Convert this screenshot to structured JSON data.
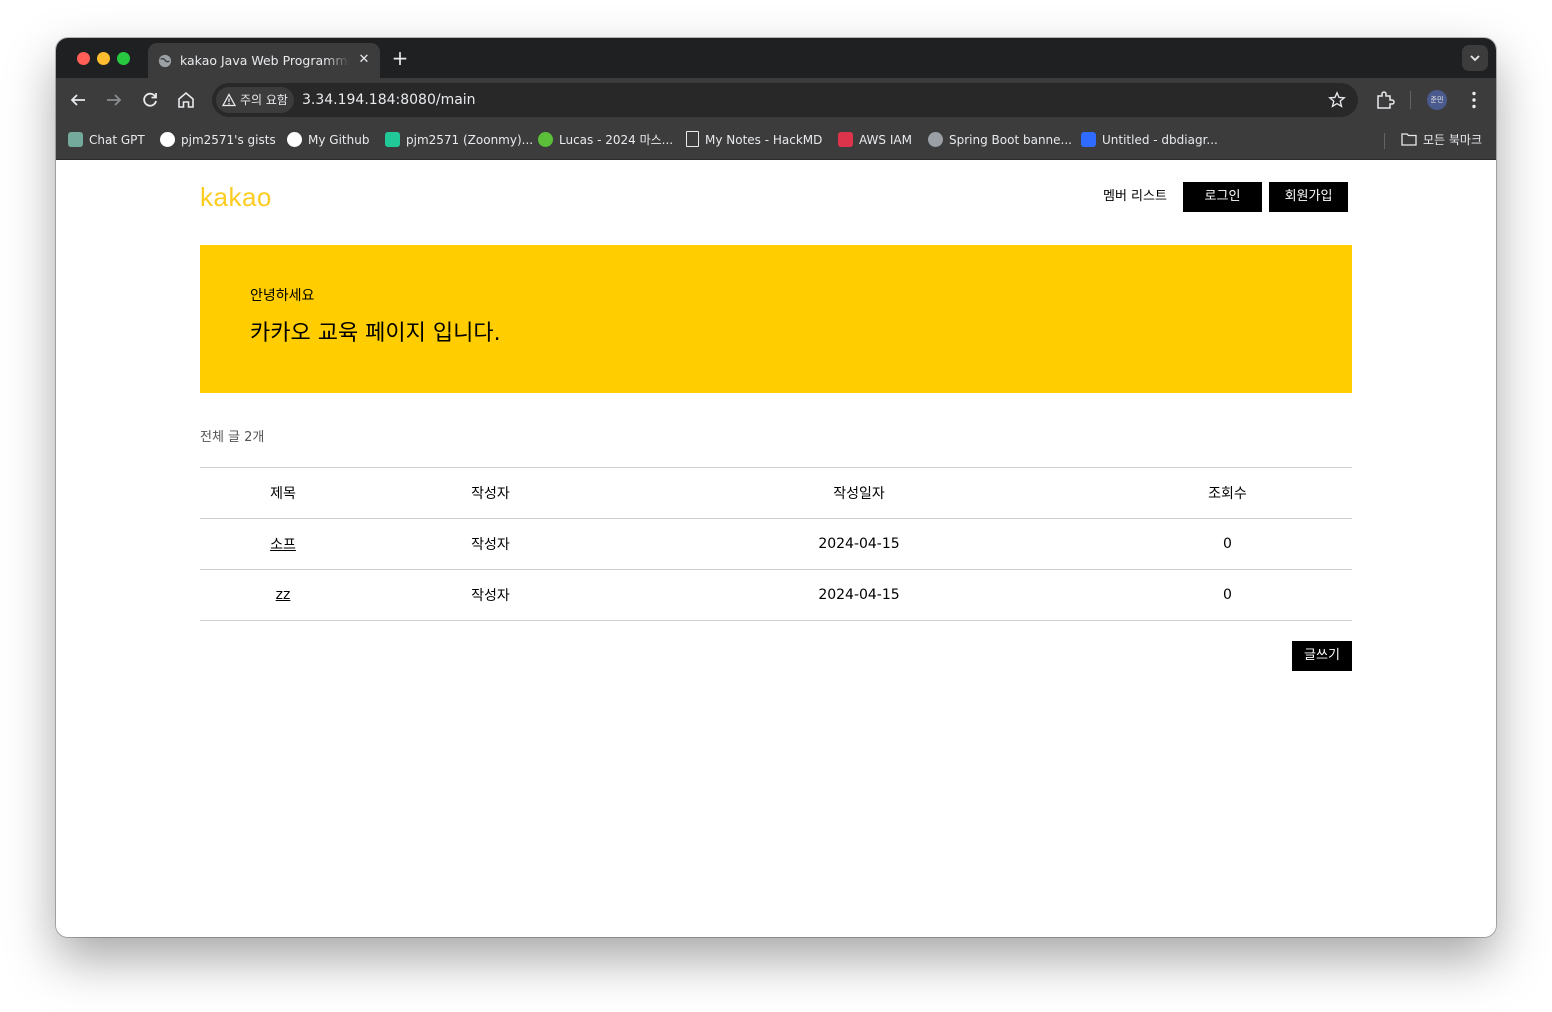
{
  "browser": {
    "tab": {
      "title": "kakao Java Web Programming"
    },
    "address": {
      "security_label": "주의 요함",
      "url": "3.34.194.184:8080/main"
    },
    "bookmarks": [
      {
        "label": "Chat GPT",
        "icon": "chatgpt-icon",
        "color": "#74aa9c"
      },
      {
        "label": "pjm2571's gists",
        "icon": "github-icon",
        "color": "#ffffff"
      },
      {
        "label": "My Github",
        "icon": "github-icon",
        "color": "#ffffff"
      },
      {
        "label": "pjm2571 (Zoonmy)...",
        "icon": "velog-icon",
        "color": "#20c997"
      },
      {
        "label": "Lucas - 2024 마스...",
        "icon": "clover-icon",
        "color": "#5bbf3a"
      },
      {
        "label": "My Notes - HackMD",
        "icon": "document-icon",
        "color": "#e8eaed"
      },
      {
        "label": "AWS IAM",
        "icon": "aws-icon",
        "color": "#dd344c"
      },
      {
        "label": "Spring Boot banne...",
        "icon": "gear-globe-icon",
        "color": "#9aa0a6"
      },
      {
        "label": "Untitled - dbdiagr...",
        "icon": "dbdiagram-icon",
        "color": "#2f6bff"
      }
    ],
    "all_bookmarks_label": "모든 북마크",
    "profile_label": "준민"
  },
  "site": {
    "logo": "kakao",
    "nav": {
      "member_list": "멤버 리스트",
      "login": "로그인",
      "signup": "회원가입"
    },
    "hero": {
      "greeting": "안녕하세요",
      "headline": "카카오 교육 페이지 입니다."
    },
    "board": {
      "count_text": "전체 글 2개",
      "columns": [
        "제목",
        "작성자",
        "작성일자",
        "조회수"
      ],
      "rows": [
        {
          "title": "소프",
          "author": "작성자",
          "date": "2024-04-15",
          "views": "0"
        },
        {
          "title": "zz",
          "author": "작성자",
          "date": "2024-04-15",
          "views": "0"
        }
      ],
      "write_button": "글쓰기"
    }
  },
  "colors": {
    "brand_yellow": "#ffcd00",
    "logo_yellow": "#fccc21",
    "button_black": "#000000"
  }
}
